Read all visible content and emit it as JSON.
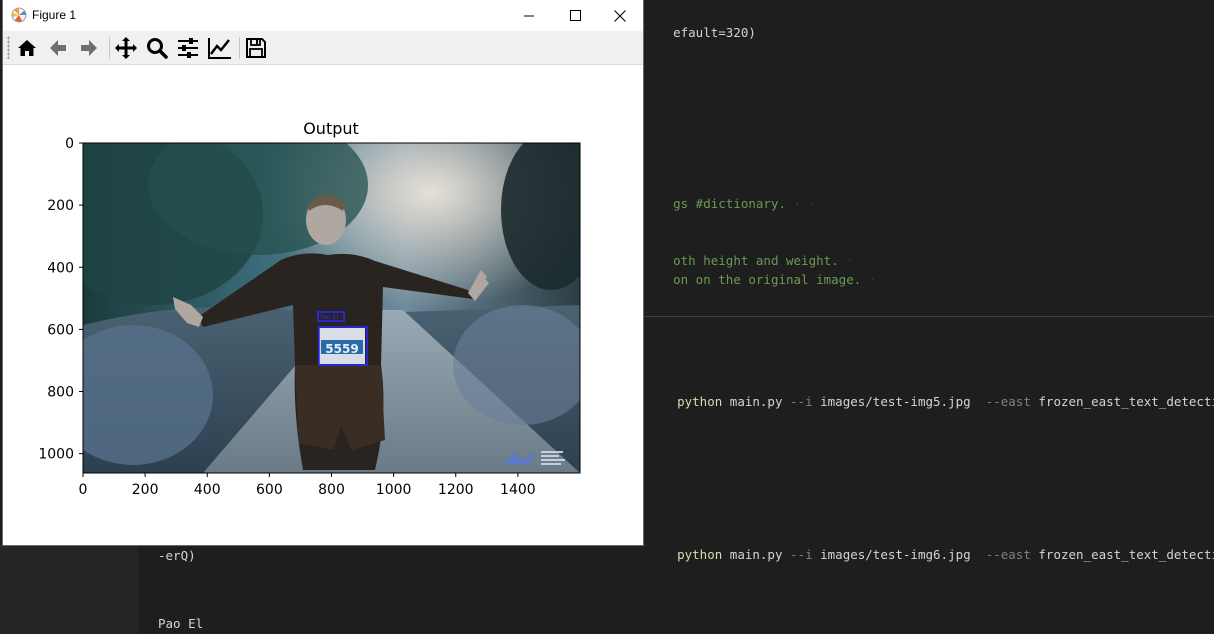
{
  "window": {
    "title": "Figure 1",
    "controls": {
      "minimize": "minimize",
      "maximize": "maximize",
      "close": "close"
    }
  },
  "toolbar": {
    "buttons": [
      {
        "name": "home-icon",
        "tooltip": "Home"
      },
      {
        "name": "back-arrow-icon",
        "tooltip": "Back"
      },
      {
        "name": "forward-arrow-icon",
        "tooltip": "Forward"
      },
      {
        "name": "pan-icon",
        "tooltip": "Pan"
      },
      {
        "name": "zoom-icon",
        "tooltip": "Zoom"
      },
      {
        "name": "subplots-config-icon",
        "tooltip": "Configure subplots"
      },
      {
        "name": "edit-axis-icon",
        "tooltip": "Edit axis"
      },
      {
        "name": "save-icon",
        "tooltip": "Save"
      }
    ]
  },
  "plot": {
    "title": "Output",
    "x_ticks": [
      "0",
      "200",
      "400",
      "600",
      "800",
      "1000",
      "1200",
      "1400"
    ],
    "y_ticks": [
      "0",
      "200",
      "400",
      "600",
      "800",
      "1000"
    ],
    "image": {
      "bib_number": "5559",
      "detected_text": "Pao El",
      "box_color": "#2a2aff"
    }
  },
  "editor": {
    "lines": [
      {
        "parts": [
          {
            "text": "efault=320)",
            "cls": "c-white"
          }
        ],
        "top_line": true
      },
      {
        "parts": [
          {
            "text": "gs #dictionary.",
            "cls": "c-green"
          }
        ]
      },
      {
        "parts": [
          {
            "text": "oth height and weight.",
            "cls": "c-green"
          }
        ]
      },
      {
        "parts": [
          {
            "text": "on on the original image.",
            "cls": "c-green"
          }
        ]
      }
    ],
    "terminal_cmd_1": {
      "python": "python",
      "script": "main.py",
      "flag_i": "--i",
      "image": "images/test-img5.jpg",
      "flag_east": "--east",
      "model": "frozen_east_text_detection.pb"
    },
    "terminal_cmd_2": {
      "python": "python",
      "script": "main.py",
      "flag_i": "--i",
      "image": "images/test-img6.jpg",
      "flag_east": "--east",
      "model": "frozen_east_text_detection.pb"
    },
    "output_line_1": "-erQ)",
    "output_line_2": "Pao El"
  },
  "colors": {
    "editor_bg": "#1e1e1e",
    "comment": "#6a9955",
    "function": "#dcdcaa",
    "param": "#9cdcfe"
  }
}
